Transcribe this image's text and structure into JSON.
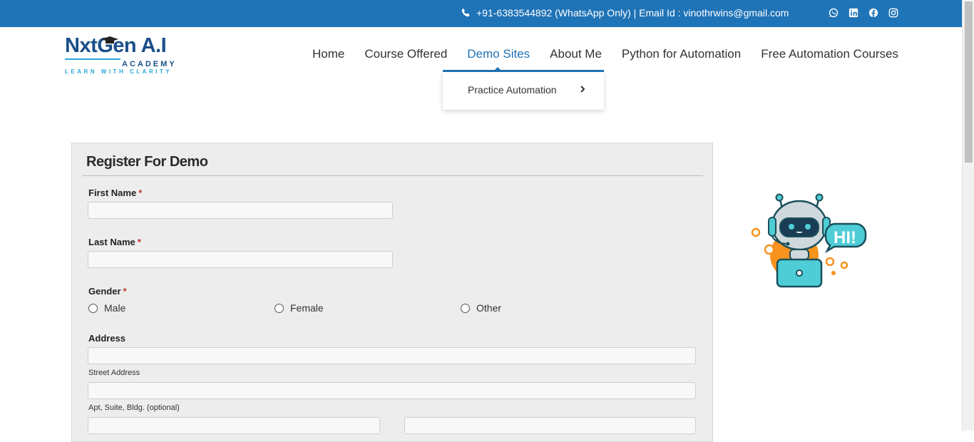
{
  "topbar": {
    "contact_text": "+91-6383544892 (WhatsApp Only) | Email Id : vinothrwins@gmail.com",
    "icons": [
      "phone-icon",
      "whatsapp-icon",
      "linkedin-icon",
      "facebook-icon",
      "instagram-icon"
    ]
  },
  "logo": {
    "main": "NxtGen A.I",
    "sub": "ACADEMY",
    "tagline": "LEARN WITH CLARITY"
  },
  "nav": {
    "items": [
      {
        "label": "Home"
      },
      {
        "label": "Course Offered"
      },
      {
        "label": "Demo Sites"
      },
      {
        "label": "About Me"
      },
      {
        "label": "Python for Automation"
      },
      {
        "label": "Free Automation Courses"
      }
    ],
    "active": "Demo Sites"
  },
  "dropdown": {
    "items": [
      {
        "label": "Practice Automation"
      }
    ]
  },
  "form": {
    "title": "Register For Demo",
    "first_name_label": "First Name",
    "last_name_label": "Last Name",
    "gender_label": "Gender",
    "required_mark": "*",
    "gender_options": [
      "Male",
      "Female",
      "Other"
    ],
    "address_label": "Address",
    "street_label": "Street Address",
    "apt_label": "Apt, Suite, Bldg. (optional)"
  },
  "robot": {
    "bubble_text": "HI!"
  },
  "colors": {
    "topbar": "#1f73b7",
    "accent": "#1f73b7",
    "required": "#c0392b",
    "panel": "#ededed"
  }
}
